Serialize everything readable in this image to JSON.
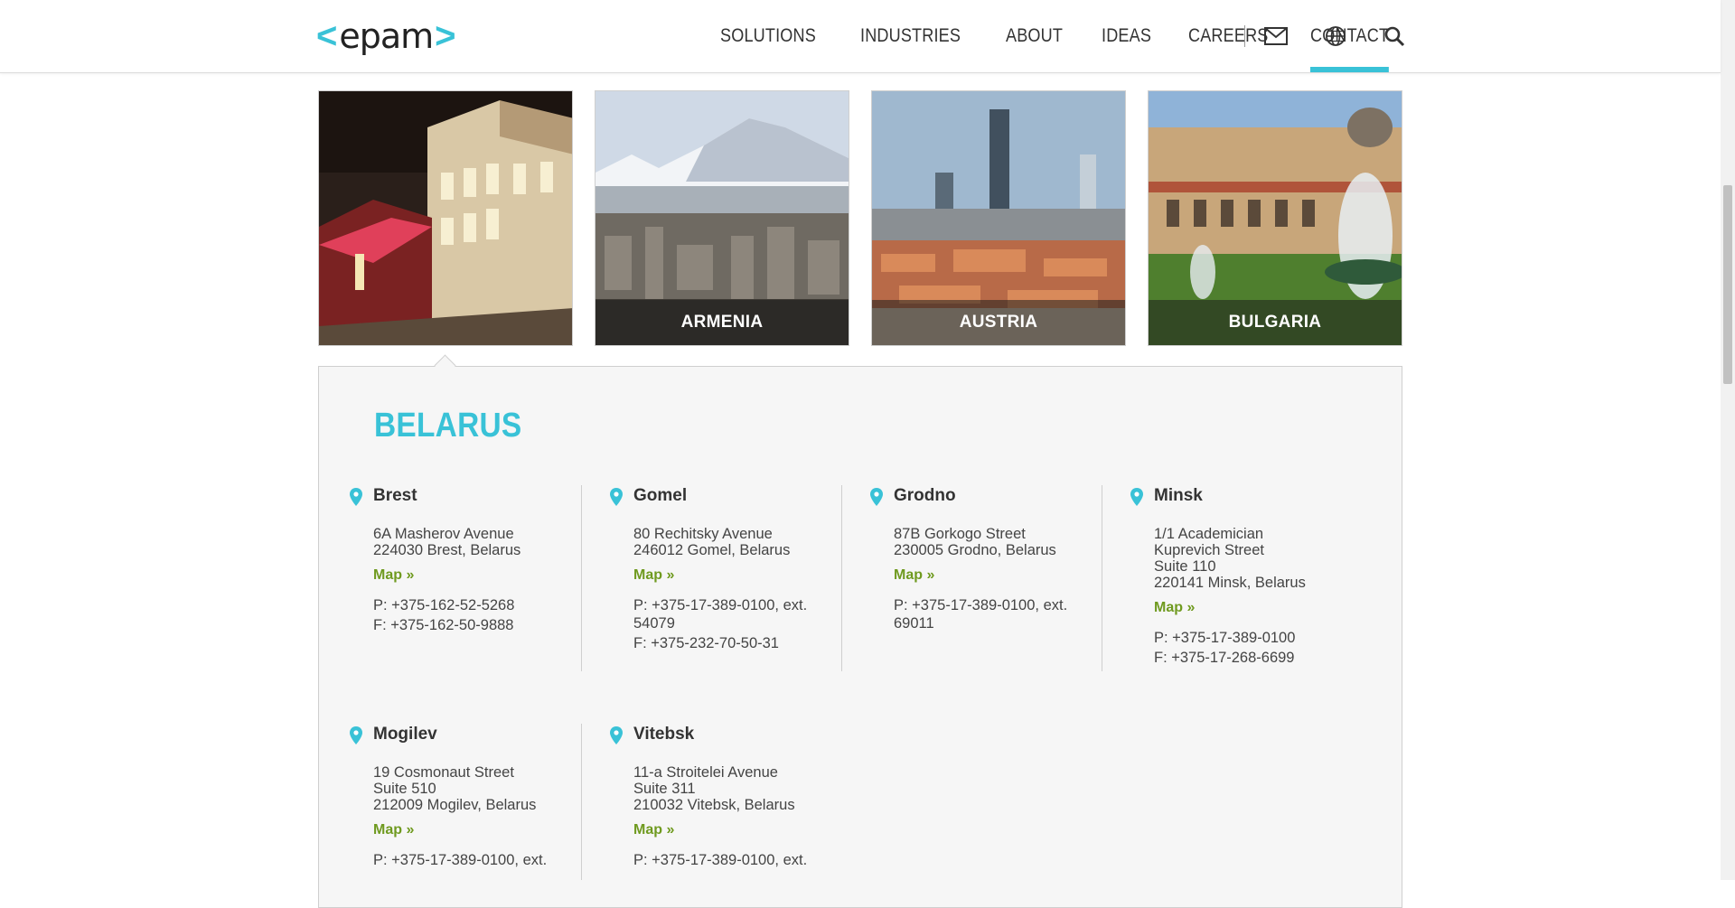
{
  "header": {
    "logo_text": "epam",
    "nav": [
      "SOLUTIONS",
      "INDUSTRIES",
      "ABOUT",
      "IDEAS",
      "CAREERS",
      "CONTACT"
    ],
    "active_nav": "CONTACT",
    "icons": [
      "mail-icon",
      "globe-icon",
      "search-icon"
    ]
  },
  "tiles": [
    {
      "name": "belarus",
      "caption": ""
    },
    {
      "name": "armenia",
      "caption": "ARMENIA"
    },
    {
      "name": "austria",
      "caption": "AUSTRIA"
    },
    {
      "name": "bulgaria",
      "caption": "BULGARIA"
    }
  ],
  "country": {
    "title": "BELARUS",
    "offices": [
      {
        "name": "Brest",
        "addr": [
          "6A Masherov Avenue",
          "224030 Brest, Belarus"
        ],
        "map": "Map »",
        "contact": [
          "P: +375-162-52-5268",
          "F: +375-162-50-9888"
        ]
      },
      {
        "name": "Gomel",
        "addr": [
          "80 Rechitsky Avenue",
          "246012 Gomel, Belarus"
        ],
        "map": "Map »",
        "contact": [
          "P: +375-17-389-0100, ext. 54079",
          "F: +375-232-70-50-31"
        ]
      },
      {
        "name": "Grodno",
        "addr": [
          "87B Gorkogo Street",
          "230005 Grodno, Belarus"
        ],
        "map": "Map »",
        "contact": [
          "P: +375-17-389-0100, ext. 69011"
        ]
      },
      {
        "name": "Minsk",
        "addr": [
          "1/1 Academician",
          "Kuprevich Street",
          "Suite 110",
          "220141 Minsk, Belarus"
        ],
        "map": "Map »",
        "contact": [
          "P: +375-17-389-0100",
          "F: +375-17-268-6699"
        ]
      },
      {
        "name": "Mogilev",
        "addr": [
          "19 Cosmonaut Street",
          "Suite 510",
          "212009 Mogilev, Belarus"
        ],
        "map": "Map »",
        "contact": [
          "P: +375-17-389-0100, ext."
        ]
      },
      {
        "name": "Vitebsk",
        "addr": [
          "11-a Stroitelei Avenue",
          "Suite 311",
          "210032 Vitebsk, Belarus"
        ],
        "map": "Map »",
        "contact": [
          "P: +375-17-389-0100, ext."
        ]
      }
    ]
  },
  "colors": {
    "accent": "#39c2d7",
    "map_link": "#6f9a1f"
  }
}
